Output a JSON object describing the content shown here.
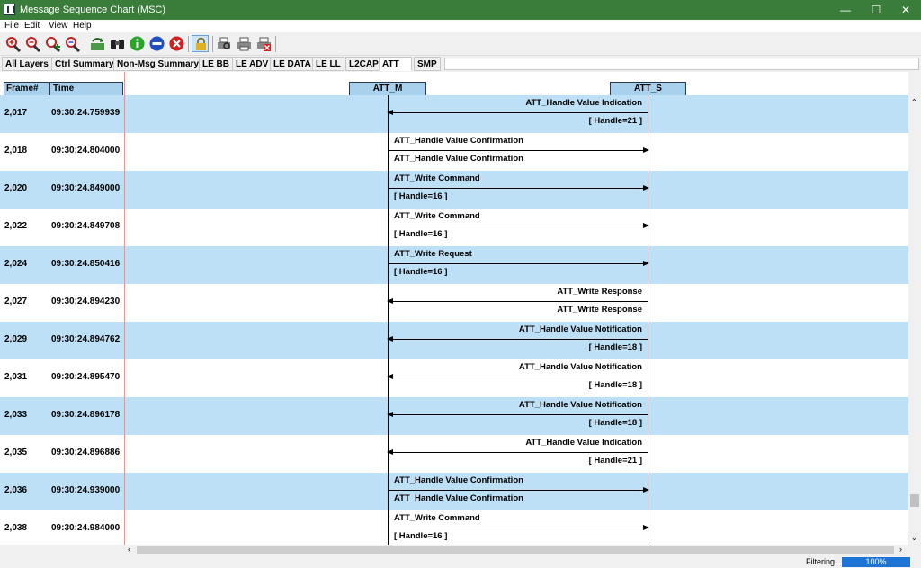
{
  "window": {
    "title": "Message Sequence Chart (MSC)",
    "min": "—",
    "max": "☐",
    "close": "✕"
  },
  "menu": [
    "File",
    "Edit",
    "View",
    "Help"
  ],
  "tabs": [
    "All Layers",
    "Ctrl Summary",
    "Non-Msg Summary",
    "LE BB",
    "LE ADV",
    "LE DATA",
    "LE LL",
    "L2CAP",
    "ATT",
    "SMP"
  ],
  "active_tab": "ATT",
  "columns": {
    "frame": "Frame#",
    "time": "Time"
  },
  "lifelines": {
    "m": "ATT_M",
    "s": "ATT_S"
  },
  "rows": [
    {
      "frame": "2,017",
      "time": "09:30:24.759939",
      "dir": "left",
      "line1": "ATT_Handle Value Indication",
      "line2": "[ Handle=21 ]"
    },
    {
      "frame": "2,018",
      "time": "09:30:24.804000",
      "dir": "right",
      "line1": "ATT_Handle Value Confirmation",
      "line2": "ATT_Handle Value Confirmation"
    },
    {
      "frame": "2,020",
      "time": "09:30:24.849000",
      "dir": "right",
      "line1": "ATT_Write Command",
      "line2": "[ Handle=16 ]"
    },
    {
      "frame": "2,022",
      "time": "09:30:24.849708",
      "dir": "right",
      "line1": "ATT_Write Command",
      "line2": "[ Handle=16 ]"
    },
    {
      "frame": "2,024",
      "time": "09:30:24.850416",
      "dir": "right",
      "line1": "ATT_Write Request",
      "line2": "[ Handle=16 ]"
    },
    {
      "frame": "2,027",
      "time": "09:30:24.894230",
      "dir": "left",
      "line1": "ATT_Write Response",
      "line2": "ATT_Write Response"
    },
    {
      "frame": "2,029",
      "time": "09:30:24.894762",
      "dir": "left",
      "line1": "ATT_Handle Value Notification",
      "line2": "[ Handle=18 ]"
    },
    {
      "frame": "2,031",
      "time": "09:30:24.895470",
      "dir": "left",
      "line1": "ATT_Handle Value Notification",
      "line2": "[ Handle=18 ]"
    },
    {
      "frame": "2,033",
      "time": "09:30:24.896178",
      "dir": "left",
      "line1": "ATT_Handle Value Notification",
      "line2": "[ Handle=18 ]"
    },
    {
      "frame": "2,035",
      "time": "09:30:24.896886",
      "dir": "left",
      "line1": "ATT_Handle Value Indication",
      "line2": "[ Handle=21 ]"
    },
    {
      "frame": "2,036",
      "time": "09:30:24.939000",
      "dir": "right",
      "line1": "ATT_Handle Value Confirmation",
      "line2": "ATT_Handle Value Confirmation"
    },
    {
      "frame": "2,038",
      "time": "09:30:24.984000",
      "dir": "right",
      "line1": "ATT_Write Command",
      "line2": "[ Handle=16 ]"
    }
  ],
  "status": {
    "filtering": "Filtering...",
    "progress": "100%",
    "progress_value": 100
  },
  "colors": {
    "titlebar": "#3a7c3a",
    "row_highlight": "#bde0f7",
    "header": "#a8d1ee",
    "progress": "#1e73d6"
  },
  "toolbar_icons": [
    "zoom-in-icon",
    "zoom-out-icon",
    "zoom-add-icon",
    "zoom-reset-icon",
    "refresh-icon",
    "binoculars-icon",
    "info-icon",
    "stop-icon",
    "cancel-icon",
    "lock-icon",
    "print-preview-icon",
    "print-icon",
    "print-cancel-icon"
  ]
}
